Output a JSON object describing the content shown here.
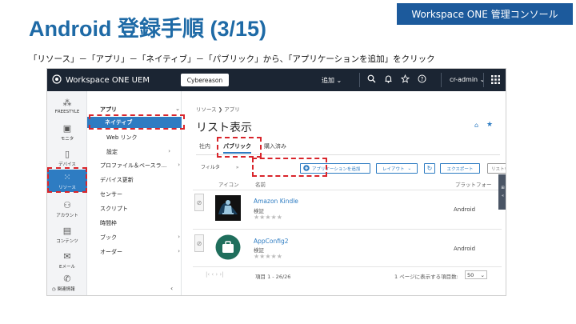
{
  "slide": {
    "title": "Android 登録手順 (3/15)",
    "badge": "Workspace ONE 管理コンソール",
    "instruction": "「リソース」－「アプリ」－「ネイティブ」－「パブリック」から、「アプリケーションを追加」をクリック"
  },
  "topbar": {
    "brand": "Workspace ONE UEM",
    "org": "Cybereason",
    "add": "追加 ⌄",
    "admin": "cr-admin ⌄"
  },
  "lnav": [
    {
      "label": "FREESTYLE",
      "icon": "freestyle-icon"
    },
    {
      "label": "モニタ",
      "icon": "monitor-icon"
    },
    {
      "label": "デバイス",
      "icon": "device-icon"
    },
    {
      "label": "リソース",
      "icon": "resources-icon"
    },
    {
      "label": "アカウント",
      "icon": "accounts-icon"
    },
    {
      "label": "コンテンツ",
      "icon": "content-icon"
    },
    {
      "label": "Eメール",
      "icon": "email-icon"
    }
  ],
  "help_label": "関連情報",
  "snav": {
    "apps": "アプリ",
    "native": "ネイティブ",
    "weblink": "Web リンク",
    "settings": "設定",
    "profiles": "プロファイル＆ベースラ...",
    "device_update": "デバイス更新",
    "sensor": "センサー",
    "script": "スクリプト",
    "timer": "時間枠",
    "book": "ブック",
    "order": "オーダー"
  },
  "content": {
    "crumb_resources": "リソース",
    "crumb_apps": "アプリ",
    "title": "リスト表示",
    "tabs": {
      "internal": "社内",
      "public": "パブリック",
      "purchased": "購入済み"
    },
    "toolbar": {
      "filter": "フィルタ",
      "add_app": "アプリケーションを追加",
      "layout": "レイアウト",
      "export": "エクスポート",
      "search_placeholder": "リストを検索"
    },
    "headers": {
      "icon": "アイコン",
      "name": "名前",
      "platform": "プラットフォー"
    },
    "apps": [
      {
        "name": "Amazon Kindle",
        "status": "検証",
        "platform": "Android"
      },
      {
        "name": "AppConfig2",
        "status": "検証",
        "platform": "Android"
      }
    ],
    "pagination": {
      "items": "項目 1 - 26/26",
      "per_page_label": "1 ページに表示する項目数:",
      "per_page_value": "50"
    }
  },
  "colors": {
    "accent": "#2e7cc2",
    "title": "#1e6aa6",
    "highlight": "#d9252b",
    "topbar": "#1b2533"
  }
}
